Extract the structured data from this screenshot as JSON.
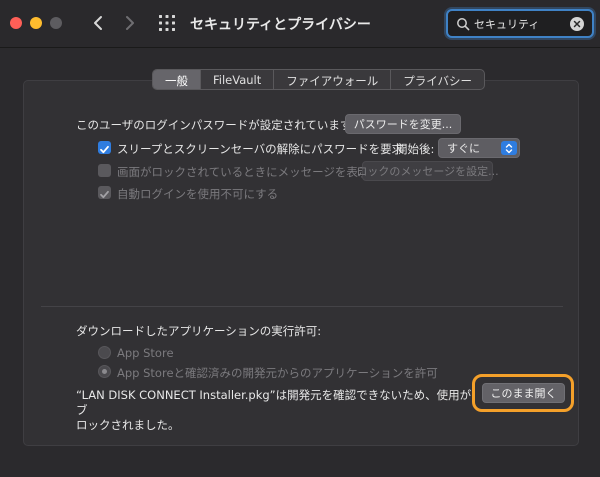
{
  "window": {
    "title": "セキュリティとプライバシー"
  },
  "search": {
    "value": "セキュリティ",
    "icon": "search-icon",
    "clear_icon": "clear-icon"
  },
  "tabs": [
    {
      "label": "一般",
      "active": true
    },
    {
      "label": "FileVault",
      "active": false
    },
    {
      "label": "ファイアウォール",
      "active": false
    },
    {
      "label": "プライバシー",
      "active": false
    }
  ],
  "general": {
    "password_text": "このユーザのログインパスワードが設定されています",
    "change_password_button": "パスワードを変更...",
    "require_password_label": "スリープとスクリーンセーバの解除にパスワードを要求",
    "start_after_label": "開始後:",
    "start_after_value": "すぐに",
    "show_message_label": "画面がロックされているときにメッセージを表示",
    "set_lock_message_button": "ロックのメッセージを設定...",
    "disable_auto_login_label": "自動ログインを使用不可にする"
  },
  "downloads": {
    "heading": "ダウンロードしたアプリケーションの実行許可:",
    "option_app_store": "App Store",
    "option_app_store_identified": "App Storeと確認済みの開発元からのアプリケーションを許可",
    "blocked_message_line1": "“LAN DISK CONNECT Installer.pkg”は開発元を確認できないため、使用がブ",
    "blocked_message_line2": "ロックされました。",
    "open_anyway_button": "このまま開く"
  },
  "colors": {
    "accent": "#2f7de0",
    "highlight": "#f4a02a",
    "close": "#fe5f57",
    "minimize": "#febc2e"
  }
}
